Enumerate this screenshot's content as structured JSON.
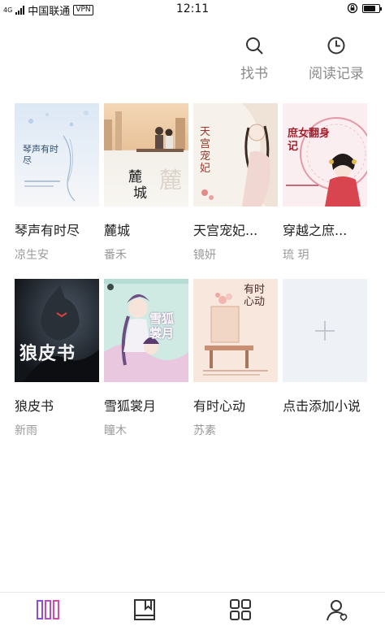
{
  "status_bar": {
    "network": "4G",
    "network_hd": "4G",
    "carrier": "中国联通",
    "vpn": "VPN",
    "time": "12:11",
    "battery_level": 0.8
  },
  "top_actions": {
    "find_books": {
      "label": "找书",
      "icon": "search-icon"
    },
    "history": {
      "label": "阅读记录",
      "icon": "clock-icon"
    }
  },
  "shelf": {
    "books": [
      {
        "title": "琴声有时尽",
        "author": "凉生安",
        "cover_text": "琴声有时尽"
      },
      {
        "title": "麓城",
        "author": "番禾",
        "cover_text": "麓城"
      },
      {
        "title": "天宫宠妃...",
        "author": "镜妍",
        "cover_text": "天宫宠妃"
      },
      {
        "title": "穿越之庶...",
        "author": "琉 玥",
        "cover_text": "庶女翻身记"
      },
      {
        "title": "狼皮书",
        "author": "新雨",
        "cover_text": "狼皮书"
      },
      {
        "title": "雪狐裳月",
        "author": "瞳木",
        "cover_text": "雪狐裳月"
      },
      {
        "title": "有时心动",
        "author": "苏素",
        "cover_text": "有时心动"
      }
    ],
    "add_label": "点击添加小说"
  },
  "bottom_nav": {
    "items": [
      {
        "icon": "bookshelf-icon",
        "active": true
      },
      {
        "icon": "book-icon",
        "active": false
      },
      {
        "icon": "grid-icon",
        "active": false
      },
      {
        "icon": "user-icon",
        "active": false
      }
    ]
  },
  "colors": {
    "accent": "#8a4fd8",
    "text": "#222222",
    "muted": "#9a9a9a",
    "icon": "#333333"
  }
}
